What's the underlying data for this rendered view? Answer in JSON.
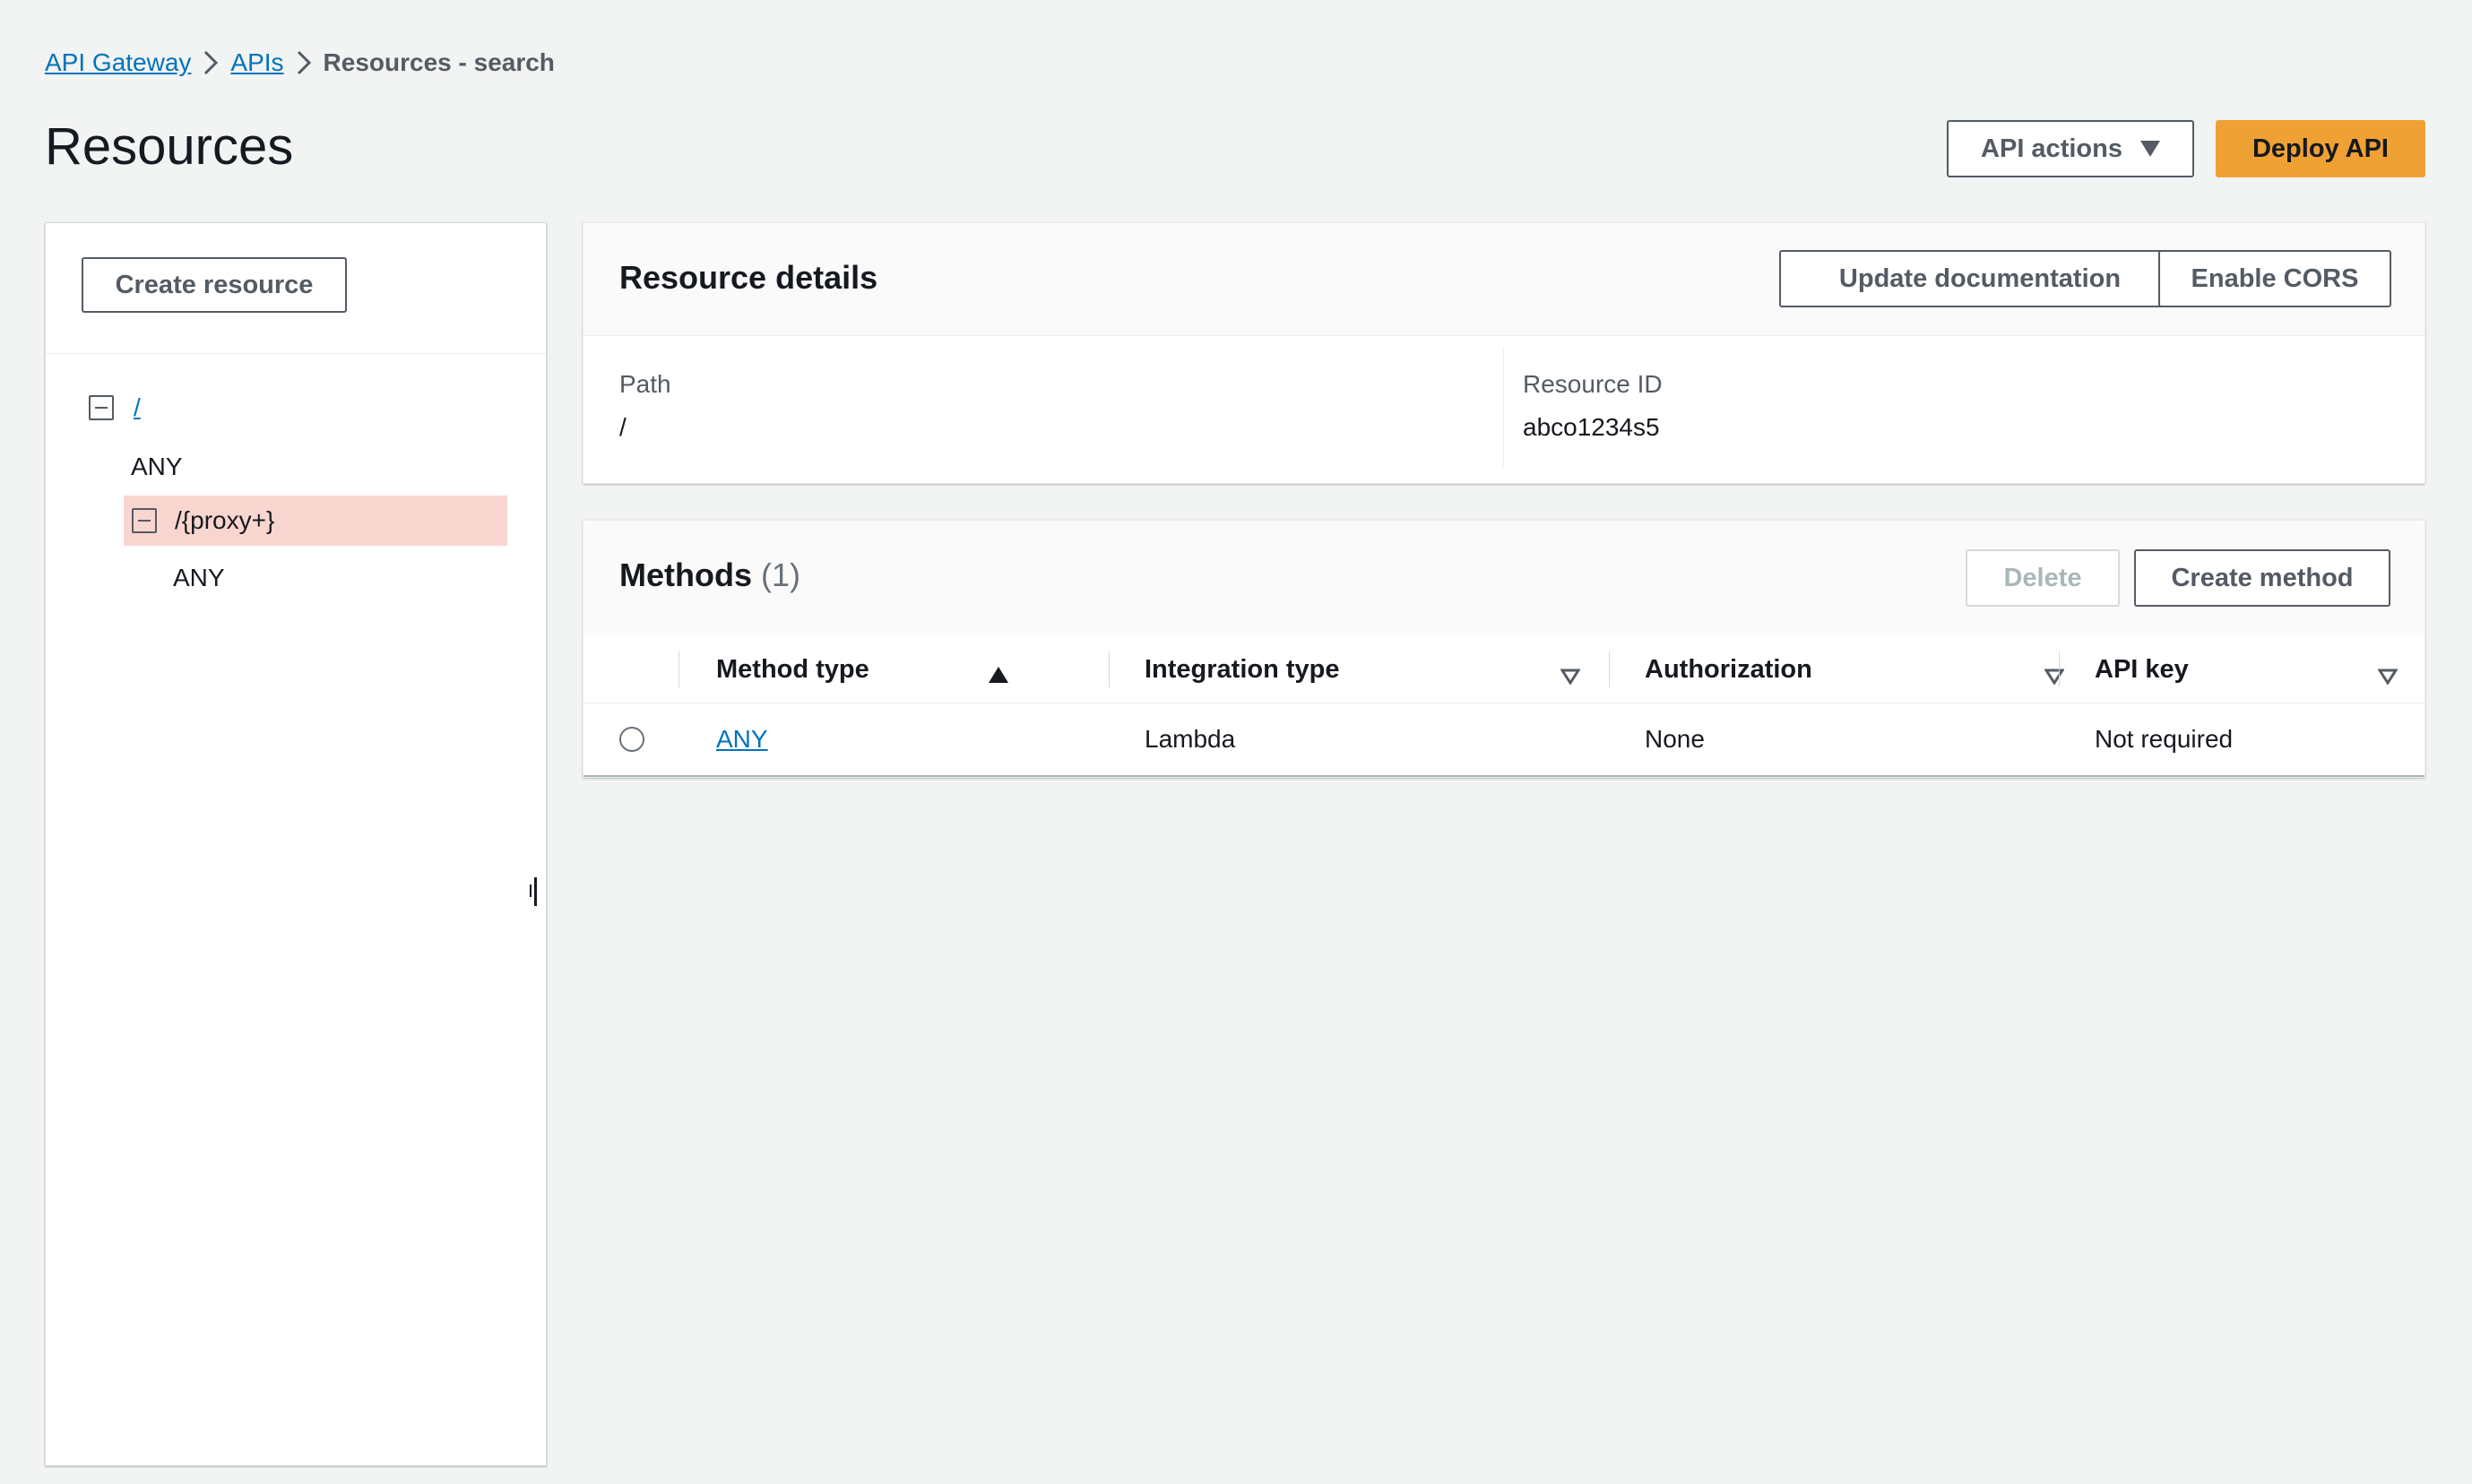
{
  "breadcrumb": {
    "items": [
      "API Gateway",
      "APIs"
    ],
    "current": "Resources - search"
  },
  "page": {
    "title": "Resources",
    "api_actions_label": "API actions",
    "deploy_label": "Deploy API"
  },
  "resources_panel": {
    "create_resource_label": "Create resource",
    "tree": {
      "root_path": "/",
      "root_method": "ANY",
      "child_path": "/{proxy+}",
      "child_method": "ANY"
    }
  },
  "resource_details": {
    "title": "Resource details",
    "update_doc_label": "Update documentation",
    "enable_cors_label": "Enable CORS",
    "path_label": "Path",
    "path_value": "/",
    "resource_id_label": "Resource ID",
    "resource_id_value": "abco1234s5"
  },
  "methods": {
    "title": "Methods",
    "count": "(1)",
    "delete_label": "Delete",
    "create_label": "Create method",
    "columns": [
      "Method type",
      "Integration type",
      "Authorization",
      "API key"
    ],
    "rows": [
      {
        "method": "ANY",
        "integration": "Lambda",
        "authorization": "None",
        "api_key": "Not required"
      }
    ]
  },
  "colors": {
    "link": "#0073bb",
    "primary_button": "#f0a133",
    "selected_row": "#f9d5d0",
    "background": "#f2f3f3"
  },
  "icons": [
    "chevron-right-icon",
    "caret-down-icon",
    "collapse-icon",
    "sort-ascending-icon",
    "sort-descending-icon",
    "radio-icon",
    "resize-handle-icon"
  ]
}
